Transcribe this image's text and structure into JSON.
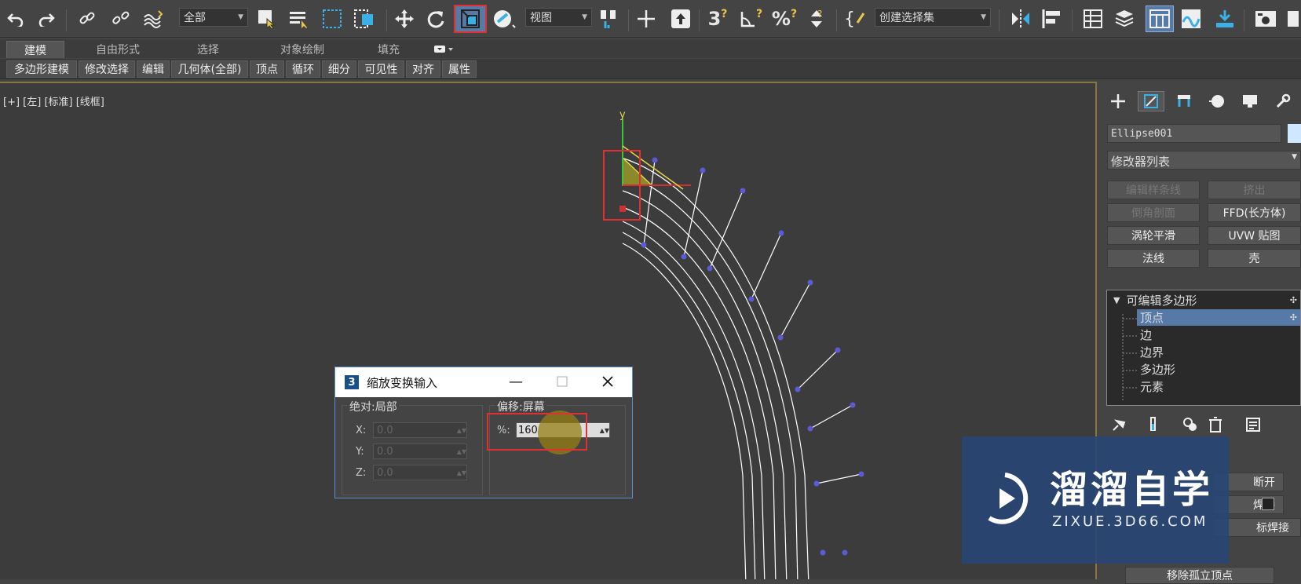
{
  "toolbar": {
    "filter_dropdown": "全部",
    "refcoord_dropdown": "视图",
    "selset_dropdown": "创建选择集",
    "icons": [
      "undo-icon",
      "redo-icon",
      "link-icon",
      "unlink-icon",
      "bind-spacewarp-icon",
      "select-object-icon",
      "select-by-name-icon",
      "rect-region-icon",
      "window-crossing-icon",
      "move-icon",
      "rotate-icon",
      "scale-icon",
      "placement-icon",
      "pivot-icon",
      "manipulate-icon",
      "keyboard-shortcut-icon",
      "snap-3d-icon",
      "angle-snap-icon",
      "percent-snap-icon",
      "spinner-snap-icon",
      "named-selection-icon",
      "mirror-icon",
      "align-icon",
      "scene-explorer-icon",
      "layer-explorer-icon",
      "ribbon-icon",
      "curve-editor-icon",
      "schematic-icon",
      "render-setup-icon"
    ],
    "snap_labels": [
      "3",
      "2",
      "%"
    ]
  },
  "ribbon": {
    "tabs": [
      "建模",
      "自由形式",
      "选择",
      "对象绘制",
      "填充"
    ],
    "subtabs": [
      "多边形建模",
      "修改选择",
      "编辑",
      "几何体(全部)",
      "顶点",
      "循环",
      "细分",
      "可见性",
      "对齐",
      "属性"
    ]
  },
  "viewport": {
    "label": "[+] [左] [标准] [线框]",
    "axis_y": "y"
  },
  "command_panel": {
    "object_name": "Ellipse001",
    "modifier_list": "修改器列表",
    "buttons": [
      {
        "label": "编辑样条线",
        "enabled": false
      },
      {
        "label": "挤出",
        "enabled": false
      },
      {
        "label": "倒角剖面",
        "enabled": false
      },
      {
        "label": "FFD(长方体)",
        "enabled": true
      },
      {
        "label": "涡轮平滑",
        "enabled": true
      },
      {
        "label": "UVW 贴图",
        "enabled": true
      },
      {
        "label": "法线",
        "enabled": true
      },
      {
        "label": "壳",
        "enabled": true
      }
    ],
    "stack": {
      "root": "可编辑多边形",
      "items": [
        "顶点",
        "边",
        "边界",
        "多边形",
        "元素"
      ],
      "selected": "顶点"
    },
    "partial_buttons": [
      "断开",
      "焊接",
      "标焊接",
      "移除孤立顶点"
    ]
  },
  "dialog": {
    "title": "缩放变换输入",
    "absolute_group": "绝对:局部",
    "offset_group": "偏移:屏幕",
    "x_label": "X:",
    "y_label": "Y:",
    "z_label": "Z:",
    "x_value": "0.0",
    "y_value": "0.0",
    "z_value": "0.0",
    "percent_label": "%:",
    "percent_value": "160"
  },
  "watermark": {
    "title": "溜溜自学",
    "url": "ZIXUE.3D66.COM"
  },
  "colors": {
    "highlight_box": "#e03030",
    "vertex": "#5b5bd6",
    "selected_item": "#5679a8",
    "dialog_border": "#5b8fd0"
  }
}
